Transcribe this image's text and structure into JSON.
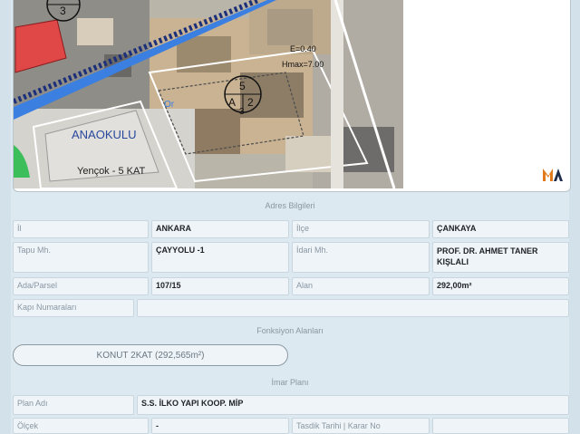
{
  "map": {
    "labels": {
      "kindergarten": "ANAOKULU",
      "kindergarten_note": "Yençok - 5 KAT",
      "parcel_top": "5",
      "parcel_letter": "A",
      "parcel_mid": "2",
      "parcel_bottom": "3",
      "corner_parcel": "3",
      "emsal": "E=0.40",
      "height": "Hmax=7.00",
      "blue_mark": "Or"
    },
    "colors": {
      "road": "#3b7fe0",
      "red_block": "#e04848",
      "green": "#3cbf5a"
    }
  },
  "address": {
    "section_title": "Adres Bilgileri",
    "il_label": "İl",
    "il_value": "ANKARA",
    "ilce_label": "İlçe",
    "ilce_value": "ÇANKAYA",
    "tapu_label": "Tapu Mh.",
    "tapu_value": "ÇAYYOLU -1",
    "idari_label": "İdari Mh.",
    "idari_value": "PROF. DR. AHMET TANER KIŞLALI",
    "ada_label": "Ada/Parsel",
    "ada_value": "107/15",
    "alan_label": "Alan",
    "alan_value": "292,00m²",
    "kapi_label": "Kapı Numaraları",
    "kapi_value": ""
  },
  "functions": {
    "section_title": "Fonksiyon Alanları",
    "item": "KONUT 2KAT (292,565m²)"
  },
  "zoning": {
    "section_title": "İmar Planı",
    "plan_label": "Plan Adı",
    "plan_value": "S.S. İLKO YAPI KOOP. MİP",
    "olcek_label": "Ölçek",
    "olcek_value": "-",
    "tasdik_label": "Tasdik Tarihi | Karar No",
    "tasdik_value": ""
  }
}
